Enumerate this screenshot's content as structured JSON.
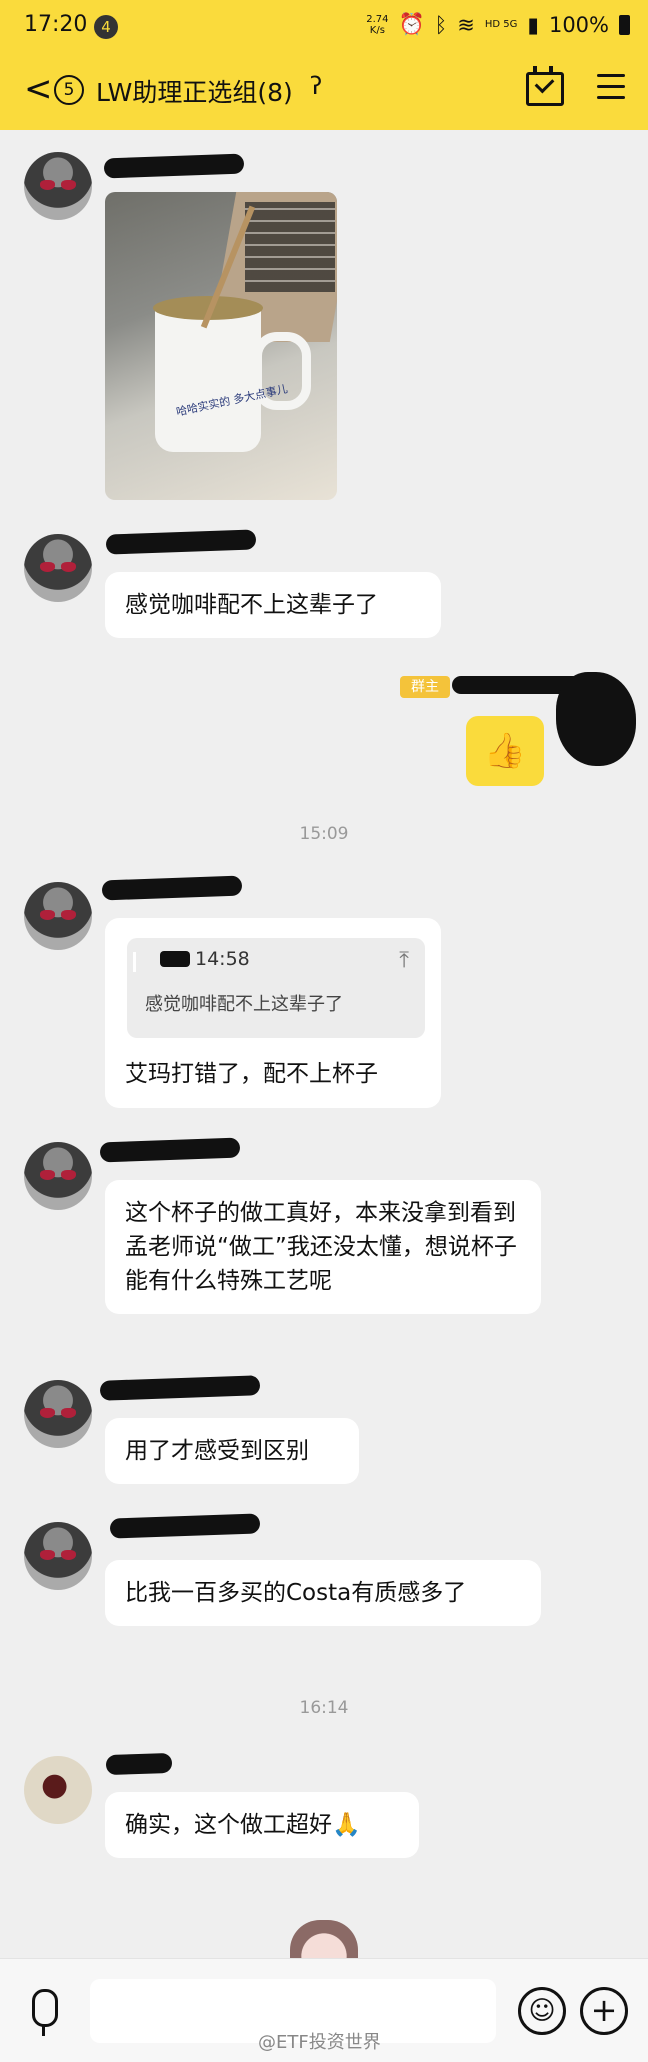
{
  "status_bar": {
    "time": "17:20",
    "notification_count": "4",
    "net_speed_value": "2.74",
    "net_speed_unit": "K/s",
    "network": "HD 5G",
    "battery": "100%"
  },
  "header": {
    "back_label": "<",
    "unread_count": "5",
    "title": "LW助理正选组(8)"
  },
  "messages": {
    "m2_text": "感觉咖啡配不上这辈子了",
    "owner_badge": "群主",
    "thumb_emoji": "👍",
    "time1": "15:09",
    "quote_time": "14:58",
    "quote_text": "感觉咖啡配不上这辈子了",
    "m4_text": "艾玛打错了，配不上杯子",
    "m5_text": "这个杯子的做工真好，本来没拿到看到孟老师说“做工”我还没太懂，想说杯子能有什么特殊工艺呢",
    "m6_text": "用了才感受到区别",
    "m7_text": "比我一百多买的Costa有质感多了",
    "time2": "16:14",
    "m8_text": "确实，这个做工超好🙏",
    "mug_print": "哈哈实实的 多大点事儿"
  },
  "input_bar": {
    "emoji_icon": "☺",
    "plus_icon": "+"
  },
  "watermark": "@ETF投资世界"
}
